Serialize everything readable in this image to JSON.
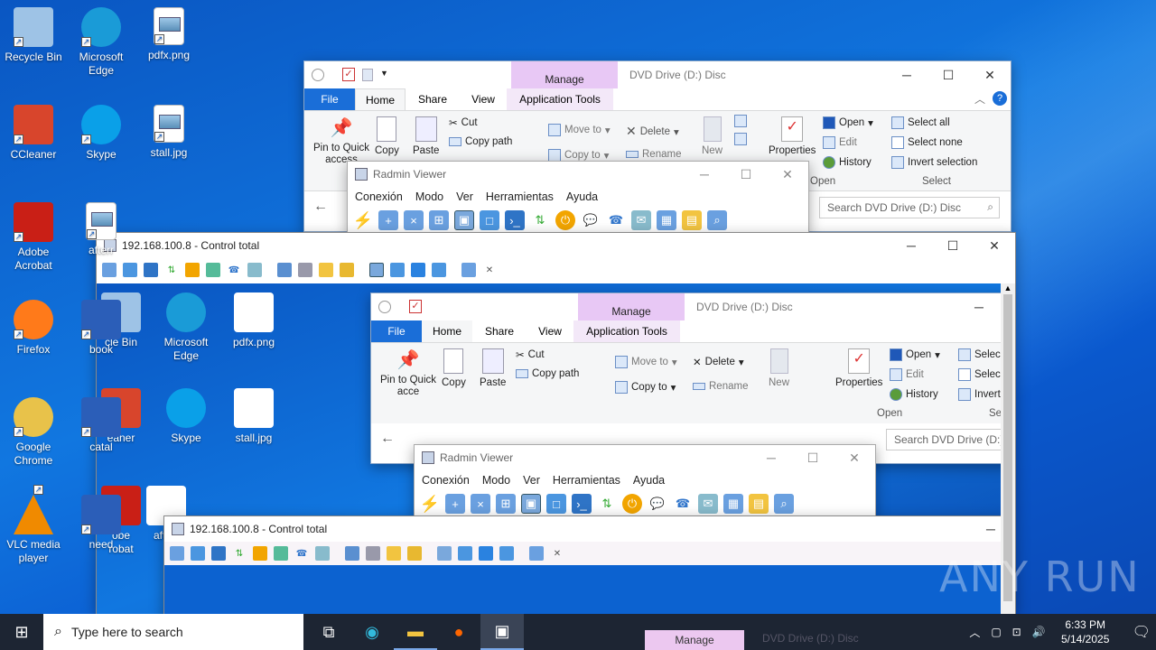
{
  "desktop": {
    "icons_left": [
      {
        "label": "Recycle Bin",
        "icon": "recycle-bin-icon"
      },
      {
        "label": "CCleaner",
        "icon": "ccleaner-icon"
      },
      {
        "label": "Adobe\nAcrobat",
        "icon": "adobe-acrobat-icon"
      },
      {
        "label": "Firefox",
        "icon": "firefox-icon"
      },
      {
        "label": "Google\nChrome",
        "icon": "chrome-icon"
      },
      {
        "label": "VLC media\nplayer",
        "icon": "vlc-icon"
      }
    ],
    "icons_col2": [
      {
        "label": "Microsoft\nEdge",
        "icon": "edge-icon"
      },
      {
        "label": "Skype",
        "icon": "skype-icon"
      },
      {
        "label": "afterr",
        "icon": "file-icon"
      },
      {
        "label": "book",
        "icon": "word-icon"
      },
      {
        "label": "catal",
        "icon": "word-icon"
      },
      {
        "label": "need",
        "icon": "word-icon"
      }
    ],
    "icons_col3": [
      {
        "label": "pdfx.png",
        "icon": "image-file-icon"
      },
      {
        "label": "stall.jpg",
        "icon": "image-file-icon"
      }
    ]
  },
  "explorer": {
    "title": "DVD Drive (D:) Disc",
    "manage_tab": "Manage",
    "tabs": [
      "File",
      "Home",
      "Share",
      "View",
      "Application Tools"
    ],
    "clipboard": {
      "pin": "Pin to Quick\naccess",
      "copy": "Copy",
      "paste": "Paste",
      "cut": "Cut",
      "copy_path": "Copy path"
    },
    "organize": {
      "move_to": "Move to",
      "copy_to": "Copy to",
      "delete": "Delete",
      "rename": "Rename"
    },
    "new": "New",
    "open_group": {
      "properties": "Properties",
      "open": "Open",
      "edit": "Edit",
      "history": "History",
      "label": "Open"
    },
    "select_group": {
      "all": "Select all",
      "none": "Select none",
      "invert": "Invert selection",
      "label": "Select"
    },
    "search_placeholder": "Search DVD Drive (D:) Disc"
  },
  "radmin": {
    "title": "Radmin Viewer",
    "menu": [
      "Conexión",
      "Modo",
      "Ver",
      "Herramientas",
      "Ayuda"
    ]
  },
  "control": {
    "title": "192.168.100.8 - Control total"
  },
  "inner_desktop": {
    "icons": [
      {
        "label": "cle Bin"
      },
      {
        "label": "Microsoft\nEdge"
      },
      {
        "label": "pdfx.png"
      },
      {
        "label": "eaner"
      },
      {
        "label": "Skype"
      },
      {
        "label": "stall.jpg"
      },
      {
        "label": "obe\nrobat"
      },
      {
        "label": "afterr"
      }
    ]
  },
  "inner_explorer": {
    "title": "DVD Drive (D:) Disc",
    "manage_tab": "Manage",
    "tabs": [
      "File",
      "Home",
      "Share",
      "View",
      "Application Tools"
    ],
    "pin": "Pin to Quick\nacce",
    "copy": "Copy",
    "paste": "Paste",
    "cut": "Cut",
    "copy_path": "Copy path",
    "move_to": "Move to",
    "copy_to": "Copy to",
    "delete": "Delete",
    "rename": "Rename",
    "new": "New",
    "properties": "Properties",
    "open": "Open",
    "edit": "Edit",
    "history": "History",
    "open_label": "Open",
    "select": "Selec",
    "invert": "Invert",
    "se_label": "Se",
    "search": "Search DVD Drive (D:) D"
  },
  "inner_radmin": {
    "title": "Radmin Viewer",
    "menu": [
      "Conexión",
      "Modo",
      "Ver",
      "Herramientas",
      "Ayuda"
    ]
  },
  "inner_control": {
    "title": "192.168.100.8 - Control total"
  },
  "taskbar": {
    "search_placeholder": "Type here to search",
    "time": "6:33 PM",
    "date": "5/14/2025",
    "ghost_manage": "Manage",
    "ghost_title": "DVD Drive (D:) Disc"
  },
  "watermark": "ANY RUN"
}
